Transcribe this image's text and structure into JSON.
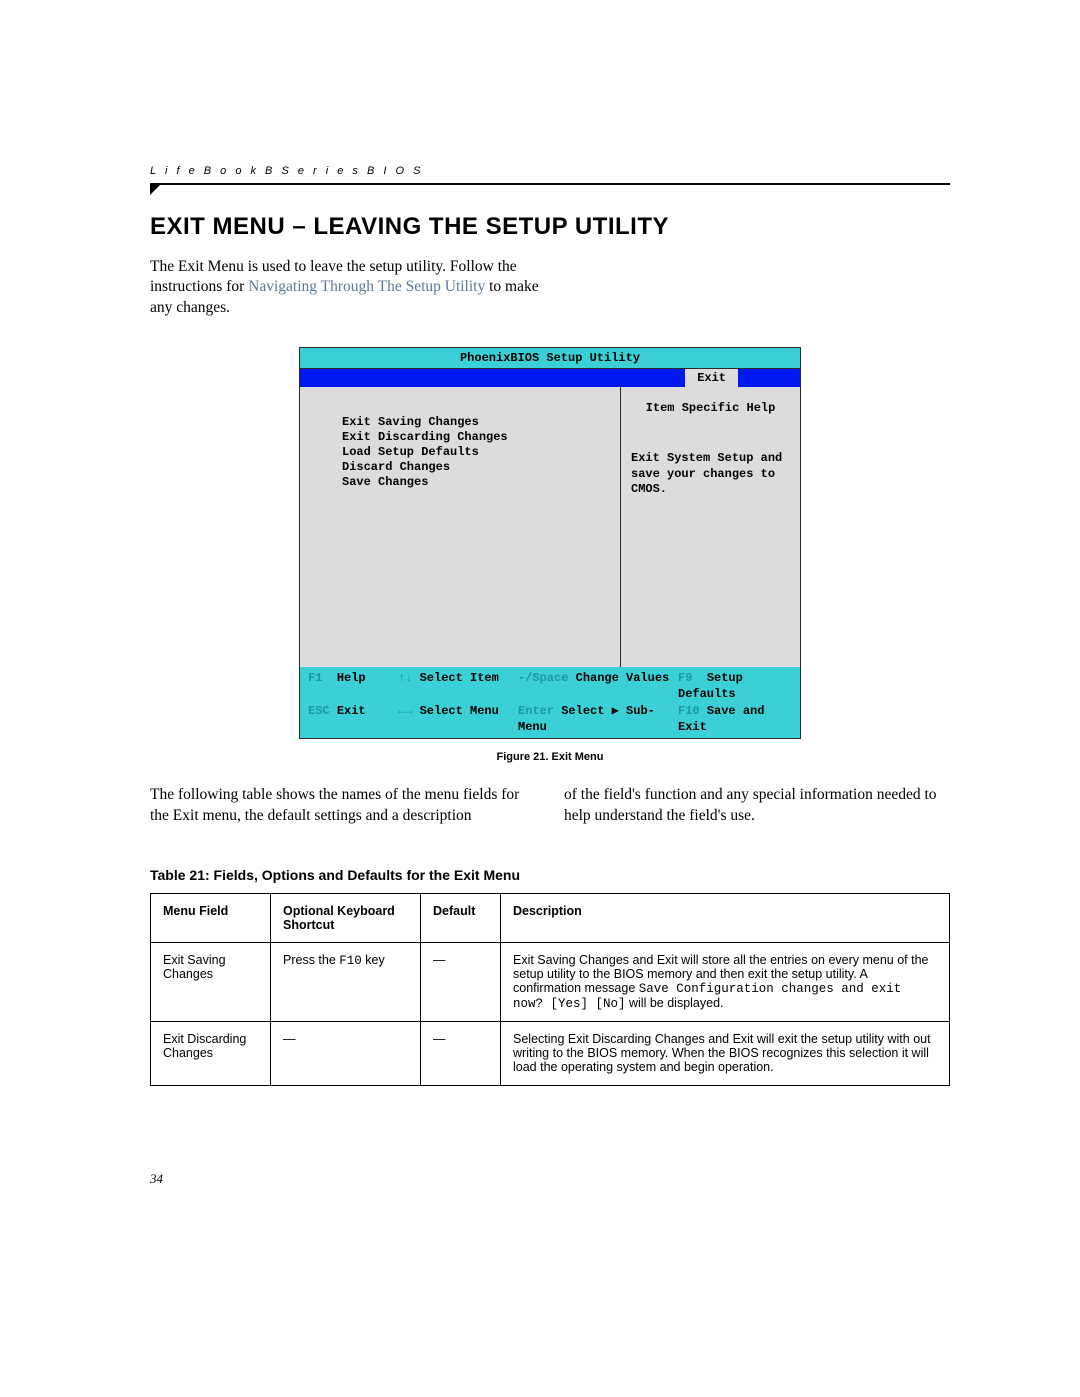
{
  "header": {
    "running_head": "L i f e B o o k  B  S e r i e s  B I O S"
  },
  "section": {
    "title": "EXIT MENU – LEAVING THE SETUP UTILITY",
    "intro_a": "The Exit Menu is used to leave the setup utility. Follow the instructions for ",
    "intro_link": "Navigating Through The Setup Utility",
    "intro_b": " to make any changes."
  },
  "bios": {
    "title": "PhoenixBIOS Setup Utility",
    "active_tab": "Exit",
    "menu_items": [
      "Exit Saving Changes",
      "Exit Discarding Changes",
      "Load Setup Defaults",
      "Discard Changes",
      "Save Changes"
    ],
    "help_title": "Item Specific Help",
    "help_text": "Exit System Setup and save your changes to CMOS.",
    "footer": {
      "row1": {
        "k1": "F1",
        "l1": "Help",
        "k2": "↑↓",
        "l2": "Select Item",
        "k3": "-/Space",
        "l3": "Change Values",
        "k4": "F9",
        "l4": "Setup Defaults"
      },
      "row2": {
        "k1": "ESC",
        "l1": "Exit",
        "k2": "←→",
        "l2": "Select Menu",
        "k3": "Enter",
        "l3": "Select ▶ Sub-Menu",
        "k4": "F10",
        "l4": "Save and Exit"
      }
    }
  },
  "figure_caption": "Figure 21.  Exit Menu",
  "body_paras": {
    "left": "The following table shows the names of the menu fields for the Exit menu, the default settings and a description",
    "right": "of the field's function and any special information needed to help understand the field's use."
  },
  "table": {
    "title": "Table 21: Fields, Options and Defaults for the Exit Menu",
    "headers": {
      "menu": "Menu Field",
      "shortcut": "Optional Keyboard Shortcut",
      "default": "Default",
      "desc": "Description"
    },
    "rows": [
      {
        "menu": "Exit Saving Changes",
        "shortcut_a": "Press the ",
        "shortcut_code": "F10",
        "shortcut_b": " key",
        "default": "—",
        "desc_a": "Exit Saving Changes and Exit will store all the entries on every menu of the setup utility to the BIOS memory and then exit the setup utility. A confirmation message ",
        "desc_code": "Save Configuration changes and exit now? [Yes] [No]",
        "desc_b": " will be displayed."
      },
      {
        "menu": "Exit Discarding Changes",
        "shortcut_a": "—",
        "shortcut_code": "",
        "shortcut_b": "",
        "default": "—",
        "desc_a": "Selecting Exit Discarding Changes and Exit will exit the setup utility with out writing to the BIOS memory. When the BIOS recognizes this selection it will load the operating system and begin operation.",
        "desc_code": "",
        "desc_b": ""
      }
    ]
  },
  "page_number": "34"
}
